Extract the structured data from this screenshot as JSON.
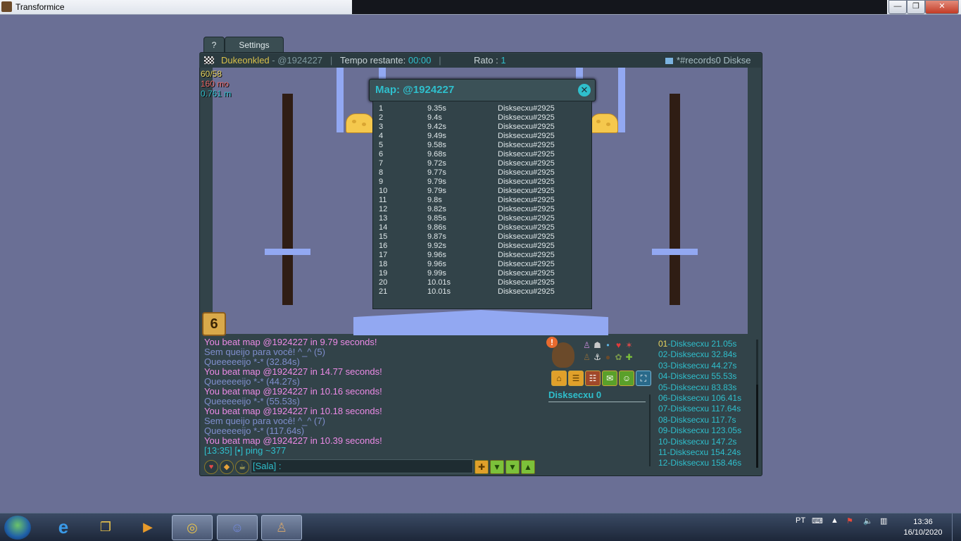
{
  "window": {
    "title": "Transformice",
    "min": "—",
    "max": "❒",
    "close": "✕"
  },
  "tabs": {
    "help": "?",
    "settings": "Settings"
  },
  "topbar": {
    "player": "Dukeonkled",
    "mapcode": "- @1924227",
    "sep": "|",
    "time_label": "Tempo restante:",
    "time_value": "00:00",
    "rato_label": "Rato :",
    "rato_value": "1",
    "channel": "*#records0 Diskse"
  },
  "stats": {
    "fps": "60/58",
    "mo": "160 mo",
    "m": "0.761 m"
  },
  "round_badge": "6",
  "popup": {
    "title": "Map: @1924227",
    "close": "✕",
    "records": [
      {
        "rank": "1",
        "time": "9.35s",
        "name": "Disksecxu#2925"
      },
      {
        "rank": "2",
        "time": "9.4s",
        "name": "Disksecxu#2925"
      },
      {
        "rank": "3",
        "time": "9.42s",
        "name": "Disksecxu#2925"
      },
      {
        "rank": "4",
        "time": "9.49s",
        "name": "Disksecxu#2925"
      },
      {
        "rank": "5",
        "time": "9.58s",
        "name": "Disksecxu#2925"
      },
      {
        "rank": "6",
        "time": "9.68s",
        "name": "Disksecxu#2925"
      },
      {
        "rank": "7",
        "time": "9.72s",
        "name": "Disksecxu#2925"
      },
      {
        "rank": "8",
        "time": "9.77s",
        "name": "Disksecxu#2925"
      },
      {
        "rank": "9",
        "time": "9.79s",
        "name": "Disksecxu#2925"
      },
      {
        "rank": "10",
        "time": "9.79s",
        "name": "Disksecxu#2925"
      },
      {
        "rank": "11",
        "time": "9.8s",
        "name": "Disksecxu#2925"
      },
      {
        "rank": "12",
        "time": "9.82s",
        "name": "Disksecxu#2925"
      },
      {
        "rank": "13",
        "time": "9.85s",
        "name": "Disksecxu#2925"
      },
      {
        "rank": "14",
        "time": "9.86s",
        "name": "Disksecxu#2925"
      },
      {
        "rank": "15",
        "time": "9.87s",
        "name": "Disksecxu#2925"
      },
      {
        "rank": "16",
        "time": "9.92s",
        "name": "Disksecxu#2925"
      },
      {
        "rank": "17",
        "time": "9.96s",
        "name": "Disksecxu#2925"
      },
      {
        "rank": "18",
        "time": "9.96s",
        "name": "Disksecxu#2925"
      },
      {
        "rank": "19",
        "time": "9.99s",
        "name": "Disksecxu#2925"
      },
      {
        "rank": "20",
        "time": "10.01s",
        "name": "Disksecxu#2925"
      },
      {
        "rank": "21",
        "time": "10.01s",
        "name": "Disksecxu#2925"
      }
    ]
  },
  "chat": {
    "lines": [
      {
        "text": "You beat map @1924227 in 9.79 seconds!",
        "color": "pink"
      },
      {
        "text": "Sem queijo para você! ^_^ (5)",
        "color": "blue"
      },
      {
        "text": "Queeeeeijo *-* (32.84s)",
        "color": "blue"
      },
      {
        "text": "You beat map @1924227 in 14.77 seconds!",
        "color": "pink"
      },
      {
        "text": "Queeeeeijo *-* (44.27s)",
        "color": "blue"
      },
      {
        "text": "You beat map @1924227 in 10.16 seconds!",
        "color": "pink"
      },
      {
        "text": "Queeeeeijo *-* (55.53s)",
        "color": "blue"
      },
      {
        "text": "You beat map @1924227 in 10.18 seconds!",
        "color": "pink"
      },
      {
        "text": "Sem queijo para você! ^_^ (7)",
        "color": "blue"
      },
      {
        "text": "Queeeeeijo *-* (117.64s)",
        "color": "blue"
      },
      {
        "text": "You beat map @1924227 in 10.39 seconds!",
        "color": "pink"
      },
      {
        "text": "[13:35] [•] ping ~377",
        "color": "teal"
      }
    ],
    "input_value": "[Sala] :",
    "quick_buttons": [
      "♥",
      "◆",
      "☕"
    ],
    "arrow_buttons": [
      "✚",
      "▼",
      "▼",
      "▲"
    ]
  },
  "panel": {
    "alert": "!",
    "player_name": "Disksecxu 0",
    "mini_icons": [
      "♙",
      "☗",
      "•",
      "♥",
      "✶",
      "♙",
      "⚓",
      "●",
      "✿",
      "✚"
    ],
    "menu_icons": [
      "⌂",
      "☰",
      "☷",
      "✉",
      "☺",
      "⛶"
    ]
  },
  "ranking": [
    {
      "num": "01",
      "name": "-Disksecxu",
      "time": "21.05s"
    },
    {
      "num": "02",
      "name": "-Disksecxu",
      "time": "32.84s"
    },
    {
      "num": "03",
      "name": "-Disksecxu",
      "time": "44.27s"
    },
    {
      "num": "04",
      "name": "-Disksecxu",
      "time": "55.53s"
    },
    {
      "num": "05",
      "name": "-Disksecxu",
      "time": "83.83s"
    },
    {
      "num": "06",
      "name": "-Disksecxu",
      "time": "106.41s"
    },
    {
      "num": "07",
      "name": "-Disksecxu",
      "time": "117.64s"
    },
    {
      "num": "08",
      "name": "-Disksecxu",
      "time": "117.7s"
    },
    {
      "num": "09",
      "name": "-Disksecxu",
      "time": "123.05s"
    },
    {
      "num": "10",
      "name": "-Disksecxu",
      "time": "147.2s"
    },
    {
      "num": "11",
      "name": "-Disksecxu",
      "time": "154.24s"
    },
    {
      "num": "12",
      "name": "-Disksecxu",
      "time": "158.46s"
    }
  ],
  "taskbar": {
    "apps": [
      "e",
      "❐",
      "▶",
      "◎",
      "☺",
      "♙"
    ],
    "lang": "PT",
    "time": "13:36",
    "date": "16/10/2020"
  }
}
